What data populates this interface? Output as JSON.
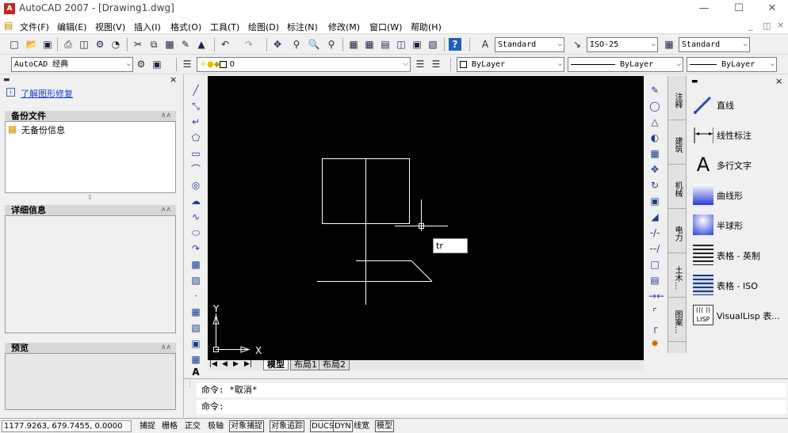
{
  "titlebar": {
    "title": "AutoCAD 2007 - [Drawing1.dwg]",
    "app_icon": "A"
  },
  "menu": [
    "文件(F)",
    "编辑(E)",
    "视图(V)",
    "插入(I)",
    "格式(O)",
    "工具(T)",
    "绘图(D)",
    "标注(N)",
    "修改(M)",
    "窗口(W)",
    "帮助(H)"
  ],
  "styles": {
    "text_style": "Standard",
    "dim_style": "ISO-25",
    "table_style": "Standard"
  },
  "workspace": "AutoCAD 经典",
  "layer": {
    "name": "0"
  },
  "properties": {
    "color": "ByLayer",
    "linetype": "ByLayer",
    "lineweight": "ByLayer"
  },
  "left_panel": {
    "help_link": "了解图形修复",
    "sections": [
      {
        "title": "备份文件",
        "items": [
          "无备份信息"
        ]
      },
      {
        "title": "详细信息",
        "items": []
      },
      {
        "title": "预览",
        "items": []
      }
    ]
  },
  "canvas": {
    "cursor_input": "tr",
    "axis_x": "X",
    "axis_y": "Y"
  },
  "layout_tabs": [
    "模型",
    "布局1",
    "布局2"
  ],
  "tool_palette": {
    "tabs": [
      "注释",
      "建筑",
      "机械",
      "电力",
      "土木...",
      "图案..."
    ],
    "items": [
      "直线",
      "线性标注",
      "多行文字",
      "曲线形",
      "半球形",
      "表格 - 英制",
      "表格 - ISO",
      "VisualLisp 表..."
    ]
  },
  "command": {
    "history": "命令: *取消*",
    "prompt": "命令:"
  },
  "status": {
    "coordinates": "1177.9263,  679.7455,  0.0000",
    "toggles": [
      {
        "label": "捕捉",
        "on": false
      },
      {
        "label": "栅格",
        "on": false
      },
      {
        "label": "正交",
        "on": false
      },
      {
        "label": "极轴",
        "on": false
      },
      {
        "label": "对象捕捉",
        "on": true
      },
      {
        "label": "对象追踪",
        "on": true
      },
      {
        "label": "DUCS",
        "on": true
      },
      {
        "label": "DYN",
        "on": true
      },
      {
        "label": "线宽",
        "on": false
      },
      {
        "label": "模型",
        "on": true
      }
    ]
  }
}
